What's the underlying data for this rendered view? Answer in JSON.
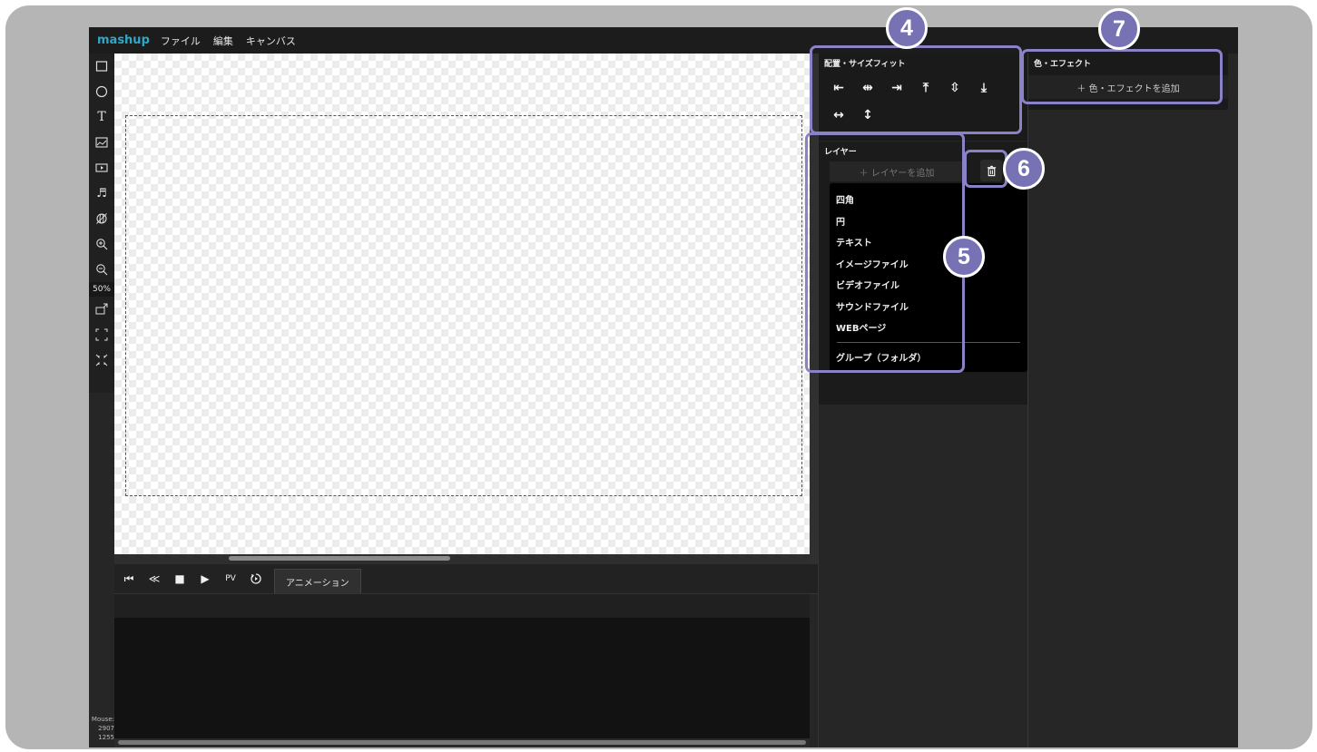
{
  "app": {
    "logo": "mashup"
  },
  "menu": [
    "ファイル",
    "編集",
    "キャンバス"
  ],
  "toolbar": {
    "tools": [
      "rect-icon",
      "circle-icon",
      "text-icon",
      "image-icon",
      "video-icon",
      "music-icon",
      "web-icon",
      "zoom-in-icon",
      "zoom-out-icon"
    ],
    "zoom_level": "50%",
    "after_tools": [
      "fit-screen-icon",
      "fullscreen-icon",
      "shrink-icon"
    ],
    "mouse_label": "Mouse:",
    "mouse_x": "2907",
    "mouse_y": "1255"
  },
  "playback": {
    "buttons": [
      "⏮",
      "≪",
      "■",
      "▶"
    ],
    "pv_label": "PV",
    "tab_label": "アニメーション"
  },
  "align_panel": {
    "title": "配置・サイズフィット",
    "buttons": [
      "⇤",
      "⇹",
      "⇥",
      "⤒",
      "⇳",
      "⤓",
      "↔",
      "↕"
    ]
  },
  "layer_panel": {
    "title": "レイヤー",
    "add_label": "＋ レイヤーを追加",
    "trash_icon": "trash-icon",
    "items": [
      "四角",
      "円",
      "テキスト",
      "イメージファイル",
      "ビデオファイル",
      "サウンドファイル",
      "WEBページ"
    ],
    "group_item": "グループ（フォルダ）"
  },
  "effect_panel": {
    "title": "色・エフェクト",
    "add_label": "＋ 色・エフェクトを追加"
  },
  "callouts": {
    "n4": "4",
    "n5": "5",
    "n6": "6",
    "n7": "7"
  },
  "colors": {
    "callout": "#7672b3",
    "accent": "#2fa8c8",
    "background": "#262626"
  }
}
